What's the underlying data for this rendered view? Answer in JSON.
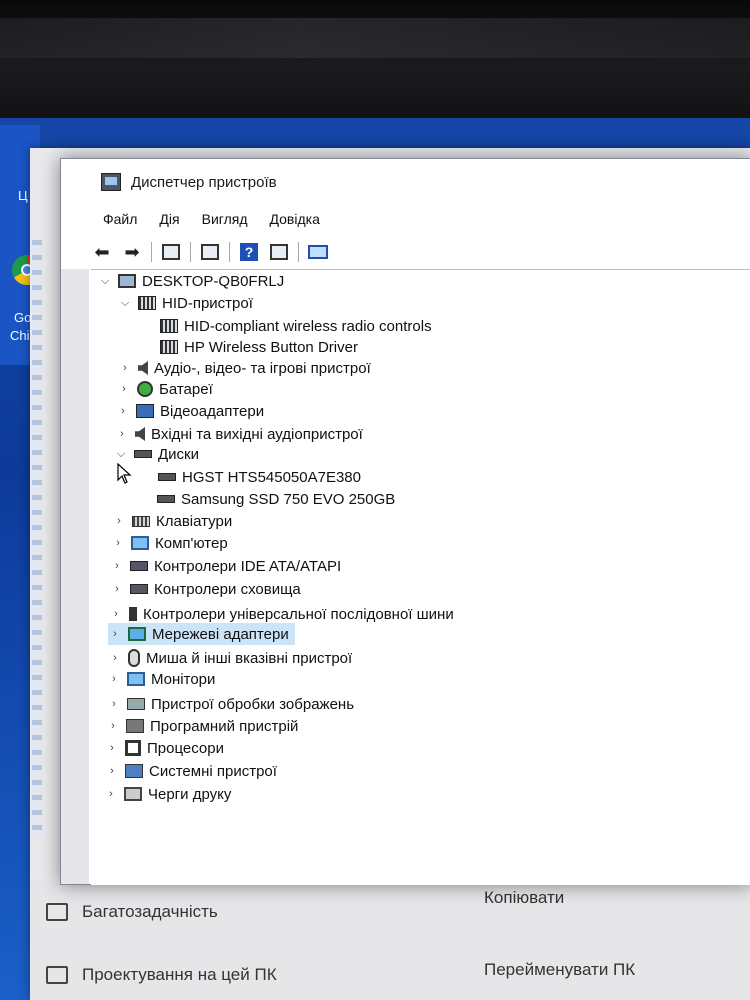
{
  "desktop": {
    "labels": [
      "Ц",
      "Go",
      "Chi"
    ]
  },
  "window": {
    "title": "Диспетчер пристроїв"
  },
  "menu": {
    "file": "Файл",
    "action": "Дія",
    "view": "Вигляд",
    "help": "Довідка"
  },
  "toolbar": {
    "icons": [
      "back-arrow-icon",
      "forward-arrow-icon",
      "properties-icon",
      "update-driver-icon",
      "help-icon",
      "window-icon",
      "scan-monitor-icon"
    ]
  },
  "tree": {
    "root": "DESKTOP-QB0FRLJ",
    "hid": {
      "label": "HID-пристрої",
      "children": [
        "HID-compliant wireless radio controls",
        "HP Wireless Button Driver"
      ]
    },
    "audio_video": "Аудіо-, відео- та ігрові пристрої",
    "batteries": "Батареї",
    "video_adapters": "Відеоадаптери",
    "audio_io": "Вхідні та вихідні аудіопристрої",
    "disks": {
      "label": "Диски",
      "children": [
        "HGST HTS545050A7E380",
        "Samsung SSD 750 EVO 250GB"
      ]
    },
    "keyboards": "Клавіатури",
    "computer": "Комп'ютер",
    "ide": "Контролери IDE ATA/ATAPI",
    "storage": "Контролери сховища",
    "usb": "Контролери універсальної послідовної шини",
    "network": "Мережеві адаптери",
    "mice": "Миша й інші вказівні пристрої",
    "monitors": "Монітори",
    "imaging": "Пристрої обробки зображень",
    "firmware": "Програмний пристрій",
    "processors": "Процесори",
    "system": "Системні пристрої",
    "print_queues": "Черги друку"
  },
  "background_settings": {
    "multitasking": "Багатозадачність",
    "projecting": "Проектування на цей ПК",
    "copy": "Копіювати",
    "rename": "Перейменувати ПК"
  }
}
